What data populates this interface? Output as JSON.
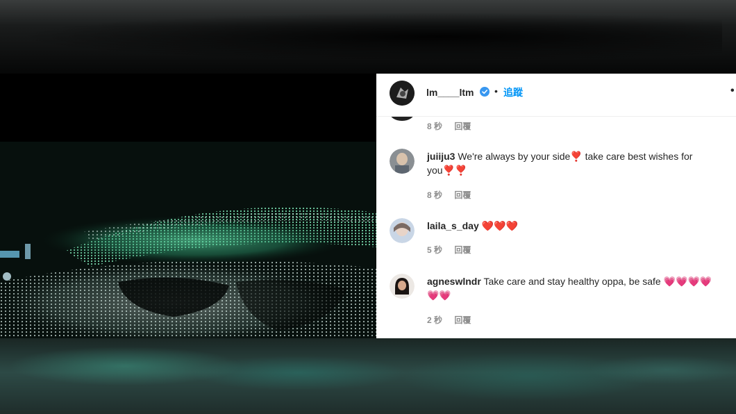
{
  "post": {
    "username": "lm____ltm",
    "separator": "•",
    "follow_label": "追蹤",
    "more_label": "•"
  },
  "comments": [
    {
      "username": "",
      "text": "",
      "time": "8 秒",
      "reply": "回覆"
    },
    {
      "username": "juiiju3",
      "text": "We're always by your side❣️ take care best wishes for you❣️❣️",
      "time": "8 秒",
      "reply": "回覆"
    },
    {
      "username": "laila_s_day",
      "text": "❤️❤️❤️",
      "time": "5 秒",
      "reply": "回覆"
    },
    {
      "username": "agneswlndr",
      "text": "Take care and stay healthy oppa, be safe 💗💗💗💗💗💗",
      "time": "2 秒",
      "reply": "回覆"
    }
  ],
  "colors": {
    "link_blue": "#0095f6",
    "verified_blue": "#3897f0",
    "meta_gray": "#8e8e8e",
    "heart_red": "#e0202a",
    "stadium_green": "#3fbf86"
  },
  "icons": {
    "verified": "verified-badge-icon",
    "more": "more-options-icon"
  }
}
